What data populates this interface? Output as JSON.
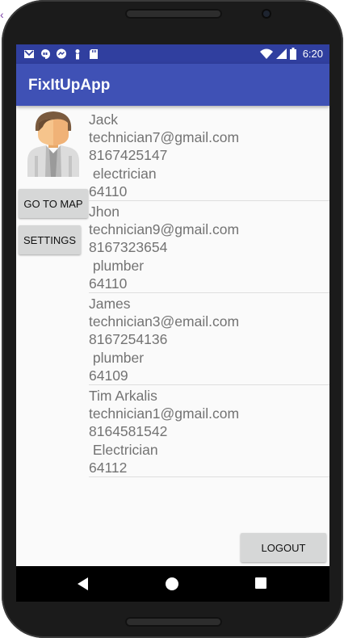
{
  "app": {
    "title": "FixItUpApp"
  },
  "status_bar": {
    "time": "6:20"
  },
  "buttons": {
    "map": "GO TO MAP",
    "settings": "SETTINGS",
    "logout": "LOGOUT"
  },
  "technicians": [
    {
      "name": "Jack",
      "email": "technician7@gmail.com",
      "phone": "8167425147",
      "trade": " electrician",
      "zip": "64110"
    },
    {
      "name": "Jhon",
      "email": "technician9@gmail.com",
      "phone": "8167323654",
      "trade": " plumber",
      "zip": "64110"
    },
    {
      "name": "James",
      "email": "technician3@email.com",
      "phone": "8167254136",
      "trade": " plumber",
      "zip": "64109"
    },
    {
      "name": "Tim Arkalis",
      "email": "technician1@gmail.com",
      "phone": "8164581542",
      "trade": " Electrician",
      "zip": "64112"
    }
  ],
  "icons": {
    "status_left": [
      "gmail-icon",
      "hangouts-icon",
      "messenger-icon",
      "person-icon",
      "sd-card-icon"
    ],
    "status_right": [
      "wifi-icon",
      "signal-icon",
      "battery-icon"
    ],
    "profile": "technician-avatar-icon",
    "nav": [
      "back-icon",
      "home-icon",
      "recent-apps-icon"
    ]
  },
  "colors": {
    "status_bar": "#303f9f",
    "app_bar": "#3f51b5",
    "background": "#fafafa",
    "text": "#737373",
    "button": "#d6d7d7"
  }
}
